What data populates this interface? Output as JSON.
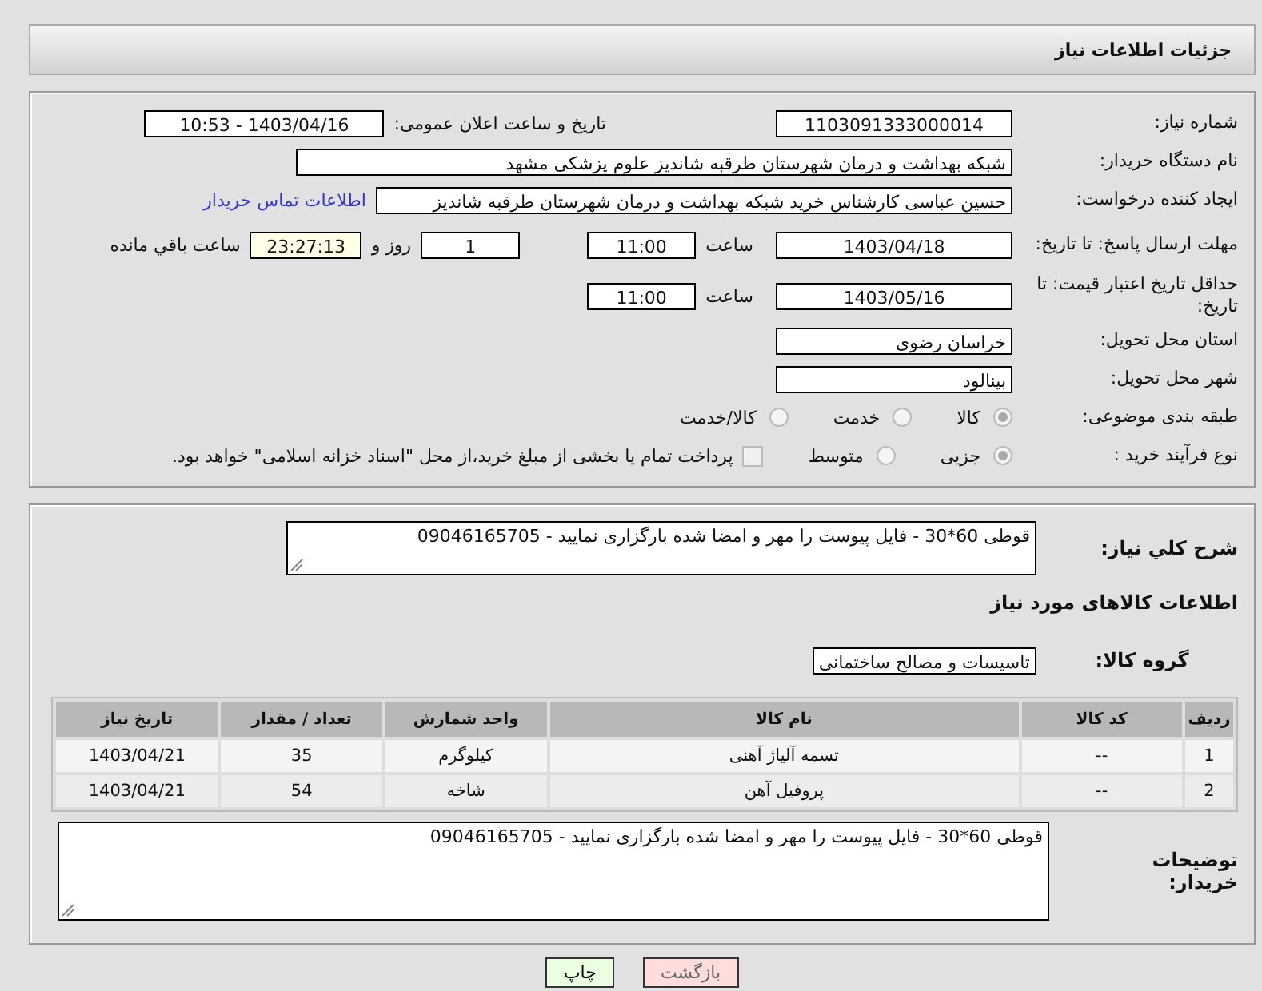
{
  "header": {
    "title": "جزئیات اطلاعات نیاز"
  },
  "need_number": {
    "label": "شماره نیاز:",
    "value": "1103091333000014"
  },
  "announce": {
    "label": "تاریخ و ساعت اعلان عمومی:",
    "value": "1403/04/16 - 10:53"
  },
  "buyer_org": {
    "label": "نام دستگاه خریدار:",
    "value": "شبکه بهداشت و درمان شهرستان طرقبه شاندیز   علوم پزشکی مشهد"
  },
  "creator": {
    "label": "ایجاد کننده درخواست:",
    "value": "حسین عباسی کارشناس خرید شبکه بهداشت و درمان شهرستان طرقبه شاندیز",
    "link": "اطلاعات تماس خریدار"
  },
  "deadline": {
    "label": "مهلت ارسال پاسخ: تا تاریخ:",
    "date": "1403/04/18",
    "time_label": "ساعت",
    "time": "11:00",
    "days": "1",
    "days_label": "روز و",
    "remaining": "23:27:13",
    "remaining_label": "ساعت باقي مانده"
  },
  "price_validity": {
    "label": "حداقل تاریخ اعتبار قیمت: تا تاریخ:",
    "date": "1403/05/16",
    "time_label": "ساعت",
    "time": "11:00"
  },
  "province": {
    "label": "استان محل تحویل:",
    "value": "خراسان رضوی"
  },
  "city": {
    "label": "شهر محل تحویل:",
    "value": "بینالود"
  },
  "category": {
    "label": "طبقه بندی موضوعی:",
    "options": [
      {
        "label": "کالا",
        "selected": true
      },
      {
        "label": "خدمت",
        "selected": false
      },
      {
        "label": "کالا/خدمت",
        "selected": false
      }
    ]
  },
  "process": {
    "label": "نوع فرآیند خرید :",
    "options": [
      {
        "label": "جزیی",
        "selected": true
      },
      {
        "label": "متوسط",
        "selected": false
      }
    ],
    "treasury": {
      "label": "پرداخت تمام یا بخشی از مبلغ خرید،از محل \"اسناد خزانه اسلامی\" خواهد بود.",
      "checked": false
    }
  },
  "summary": {
    "label": "شرح کلي نياز:",
    "value": "قوطی 60*30 - فایل پیوست را مهر و امضا شده بارگزاری نمایید - 09046165705"
  },
  "goods_title": "اطلاعات کالاهای مورد نیاز",
  "goods_group": {
    "label": "گروه کالا:",
    "value": "تاسیسات و مصالح ساختمانی"
  },
  "table": {
    "columns": [
      "ردیف",
      "کد کالا",
      "نام کالا",
      "واحد شمارش",
      "تعداد / مقدار",
      "تاریخ نیاز"
    ],
    "rows": [
      [
        "1",
        "--",
        "تسمه آلیاژ آهنی",
        "کیلوگرم",
        "35",
        "1403/04/21"
      ],
      [
        "2",
        "--",
        "پروفیل آهن",
        "شاخه",
        "54",
        "1403/04/21"
      ]
    ]
  },
  "buyer_notes": {
    "label": "توضیحات خریدار:",
    "value": "قوطی 60*30 - فایل پیوست را مهر و امضا شده بارگزاری نمایید - 09046165705"
  },
  "buttons": [
    {
      "label": "بازگشت",
      "kind": "back"
    },
    {
      "label": "چاپ",
      "kind": "print"
    }
  ]
}
